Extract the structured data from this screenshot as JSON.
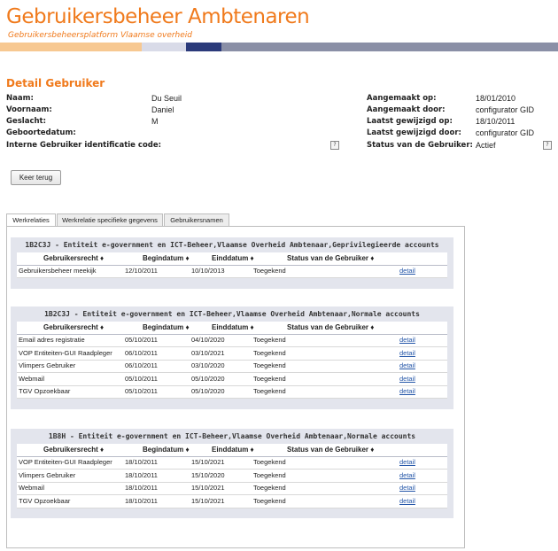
{
  "banner": {
    "title": "Gebruikersbeheer Ambtenaren",
    "subtitle": "Gebruikersbeheersplatform Vlaamse overheid"
  },
  "section_title": "Detail Gebruiker",
  "details_left": [
    {
      "label": "Naam:",
      "value": "Du Seuil"
    },
    {
      "label": "Voornaam:",
      "value": "Daniel"
    },
    {
      "label": "Geslacht:",
      "value": "M"
    },
    {
      "label": "Geboortedatum:",
      "value": ""
    },
    {
      "label": "Interne Gebruiker identificatie code:",
      "value": ""
    }
  ],
  "details_right": [
    {
      "label": "Aangemaakt op:",
      "value": "18/01/2010"
    },
    {
      "label": "Aangemaakt door:",
      "value": "configurator GID"
    },
    {
      "label": "Laatst gewijzigd op:",
      "value": "18/10/2011"
    },
    {
      "label": "Laatst gewijzigd door:",
      "value": "configurator GID"
    },
    {
      "label": "Status van de Gebruiker:",
      "value": "Actief"
    }
  ],
  "help_glyph": "?",
  "back_button": "Keer terug",
  "tabs": [
    "Werkrelaties",
    "Werkrelatie specifieke gegevens",
    "Gebruikersnamen"
  ],
  "columns": [
    "Gebruikersrecht ♦",
    "Begindatum ♦",
    "Einddatum ♦",
    "Status van de Gebruiker ♦"
  ],
  "groups": [
    {
      "title": "1B2C3J - Entiteit e-government en ICT-Beheer,Vlaamse Overheid Ambtenaar,Geprivilegieerde accounts",
      "rows": [
        [
          "Gebruikersbeheer meekijk",
          "12/10/2011",
          "10/10/2013",
          "Toegekend",
          "detail"
        ]
      ]
    },
    {
      "title": "1B2C3J - Entiteit e-government en ICT-Beheer,Vlaamse Overheid Ambtenaar,Normale accounts",
      "rows": [
        [
          "Email adres registratie",
          "05/10/2011",
          "04/10/2020",
          "Toegekend",
          "detail"
        ],
        [
          "VOP Entiteiten-GUI Raadpleger",
          "06/10/2011",
          "03/10/2021",
          "Toegekend",
          "detail"
        ],
        [
          "Vlimpers Gebruiker",
          "06/10/2011",
          "03/10/2020",
          "Toegekend",
          "detail"
        ],
        [
          "Webmail",
          "05/10/2011",
          "05/10/2020",
          "Toegekend",
          "detail"
        ],
        [
          "TGV Opzoekbaar",
          "05/10/2011",
          "05/10/2020",
          "Toegekend",
          "detail"
        ]
      ]
    },
    {
      "title": "1B8H - Entiteit e-government en ICT-Beheer,Vlaamse Overheid Ambtenaar,Normale accounts",
      "rows": [
        [
          "VOP Entiteiten-GUI Raadpleger",
          "18/10/2011",
          "15/10/2021",
          "Toegekend",
          "detail"
        ],
        [
          "Vlimpers Gebruiker",
          "18/10/2011",
          "15/10/2020",
          "Toegekend",
          "detail"
        ],
        [
          "Webmail",
          "18/10/2011",
          "15/10/2021",
          "Toegekend",
          "detail"
        ],
        [
          "TGV Opzoekbaar",
          "18/10/2011",
          "15/10/2021",
          "Toegekend",
          "detail"
        ]
      ]
    }
  ]
}
